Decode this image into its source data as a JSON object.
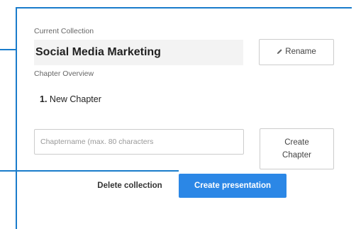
{
  "collection": {
    "current_label": "Current Collection",
    "name": "Social Media Marketing",
    "rename_label": "Rename"
  },
  "chapters": {
    "overview_label": "Chapter Overview",
    "items": [
      {
        "number": "1.",
        "title": "New Chapter"
      }
    ],
    "input_placeholder": "Chaptername (max. 80 characters",
    "create_label_line1": "Create",
    "create_label_line2": "Chapter"
  },
  "actions": {
    "delete_label": "Delete collection",
    "create_presentation_label": "Create presentation"
  },
  "colors": {
    "accent": "#2b87e6",
    "frame_line": "#1a7ccb"
  },
  "icons": {
    "rename": "pencil-icon"
  }
}
